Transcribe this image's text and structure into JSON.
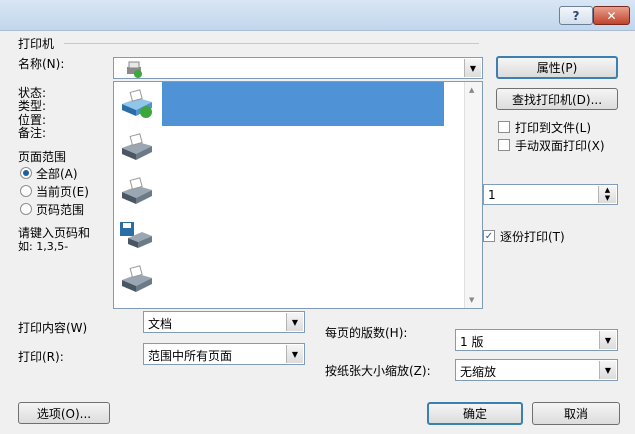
{
  "titlebar": {
    "help": "?",
    "close": "✕"
  },
  "printer": {
    "group": "打印机",
    "name_label": "名称(N):",
    "status_label": "状态:",
    "type_label": "类型:",
    "location_label": "位置:",
    "comment_label": "备注:",
    "properties_button": "属性(P)",
    "find_printer_button": "查找打印机(D)...",
    "print_to_file": "打印到文件(L)",
    "manual_duplex": "手动双面打印(X)"
  },
  "page_range": {
    "group": "页面范围",
    "all": "全部(A)",
    "current": "当前页(E)",
    "pages": "页码范围",
    "hint_line1": "请键入页码和",
    "hint_line2": "如: 1,3,5-"
  },
  "copies": {
    "value": "1",
    "collate": "逐份打印(T)"
  },
  "print_what": {
    "label": "打印内容(W)",
    "value": "文档"
  },
  "print": {
    "label": "打印(R):",
    "value": "范围中所有页面"
  },
  "zoom": {
    "pages_per_sheet_label": "每页的版数(H):",
    "pages_per_sheet_value": "1 版",
    "scale_label": "按纸张大小缩放(Z):",
    "scale_value": "无缩放"
  },
  "footer": {
    "options": "选项(O)...",
    "ok": "确定",
    "cancel": "取消"
  },
  "colors": {
    "selection": "#4f93d6",
    "titlebar": "#c8daee",
    "close": "#c0432b"
  }
}
